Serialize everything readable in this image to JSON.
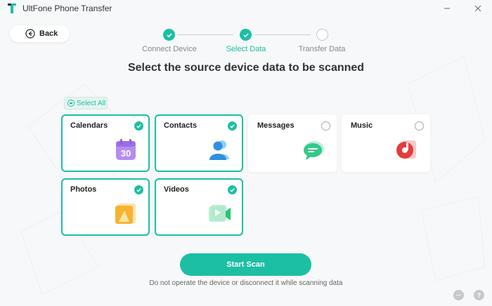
{
  "app": {
    "title": "UltFone Phone Transfer",
    "accent_color": "#1cbfa3"
  },
  "window_controls": {
    "minimize_icon": "minimize-icon",
    "close_icon": "close-icon"
  },
  "back_button": {
    "label": "Back",
    "icon": "arrow-left-circle-icon"
  },
  "stepper": {
    "steps": [
      {
        "label": "Connect Device",
        "state": "done"
      },
      {
        "label": "Select Data",
        "state": "current"
      },
      {
        "label": "Transfer Data",
        "state": "pending"
      }
    ]
  },
  "main": {
    "title": "Select the source device data to be scanned",
    "select_all_label": "Select All",
    "cards": [
      {
        "label": "Calendars",
        "selected": true,
        "icon": "calendar-icon",
        "icon_text": "30"
      },
      {
        "label": "Contacts",
        "selected": true,
        "icon": "contacts-icon"
      },
      {
        "label": "Messages",
        "selected": false,
        "icon": "messages-icon"
      },
      {
        "label": "Music",
        "selected": false,
        "icon": "music-icon"
      },
      {
        "label": "Photos",
        "selected": true,
        "icon": "photos-icon"
      },
      {
        "label": "Videos",
        "selected": true,
        "icon": "videos-icon"
      }
    ]
  },
  "footer": {
    "start_button_label": "Start Scan",
    "note": "Do not operate the device or disconnect it while scanning data",
    "feedback_icon": "chat-bubble-icon",
    "help_icon": "help-icon",
    "help_label": "?"
  }
}
